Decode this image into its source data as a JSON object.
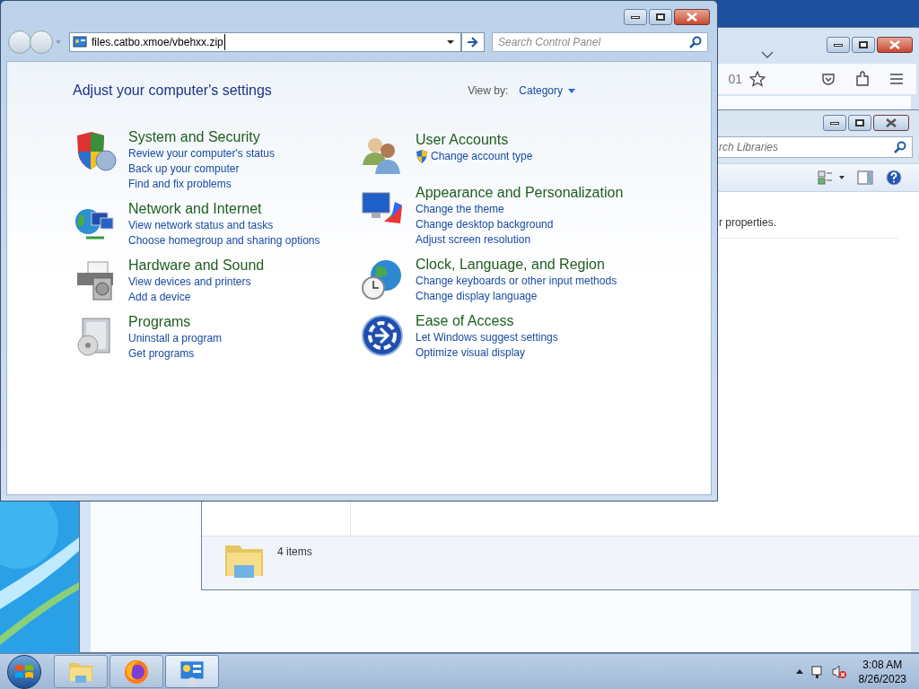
{
  "browser": {
    "url_fragment": "01"
  },
  "explorer": {
    "search_placeholder": "rch Libraries",
    "message": "r properties.",
    "status": "4 items"
  },
  "control_panel": {
    "address": "files.catbo.xmoe/vbehxx.zip",
    "search_placeholder": "Search Control Panel",
    "heading": "Adjust your computer's settings",
    "view_by_label": "View by:",
    "view_by_value": "Category",
    "columns": [
      [
        {
          "kind": "security",
          "title": "System and Security",
          "links": [
            {
              "text": "Review your computer's status",
              "shield": false
            },
            {
              "text": "Back up your computer",
              "shield": false
            },
            {
              "text": "Find and fix problems",
              "shield": false
            }
          ]
        },
        {
          "kind": "network",
          "title": "Network and Internet",
          "links": [
            {
              "text": "View network status and tasks",
              "shield": false
            },
            {
              "text": "Choose homegroup and sharing options",
              "shield": false
            }
          ]
        },
        {
          "kind": "printer",
          "title": "Hardware and Sound",
          "links": [
            {
              "text": "View devices and printers",
              "shield": false
            },
            {
              "text": "Add a device",
              "shield": false
            }
          ]
        },
        {
          "kind": "programs",
          "title": "Programs",
          "links": [
            {
              "text": "Uninstall a program",
              "shield": false
            },
            {
              "text": "Get programs",
              "shield": false
            }
          ]
        }
      ],
      [
        {
          "kind": "users",
          "title": "User Accounts",
          "links": [
            {
              "text": "Change account type",
              "shield": true
            }
          ]
        },
        {
          "kind": "appearance",
          "title": "Appearance and Personalization",
          "links": [
            {
              "text": "Change the theme",
              "shield": false
            },
            {
              "text": "Change desktop background",
              "shield": false
            },
            {
              "text": "Adjust screen resolution",
              "shield": false
            }
          ]
        },
        {
          "kind": "clock",
          "title": "Clock, Language, and Region",
          "links": [
            {
              "text": "Change keyboards or other input methods",
              "shield": false
            },
            {
              "text": "Change display language",
              "shield": false
            }
          ]
        },
        {
          "kind": "ease",
          "title": "Ease of Access",
          "links": [
            {
              "text": "Let Windows suggest settings",
              "shield": false
            },
            {
              "text": "Optimize visual display",
              "shield": false
            }
          ]
        }
      ]
    ]
  },
  "taskbar": {
    "buttons": [
      {
        "kind": "explorer",
        "selected": false
      },
      {
        "kind": "firefox",
        "selected": false
      },
      {
        "kind": "control_panel",
        "selected": true
      }
    ],
    "time": "3:08 AM",
    "date": "8/26/2023"
  }
}
